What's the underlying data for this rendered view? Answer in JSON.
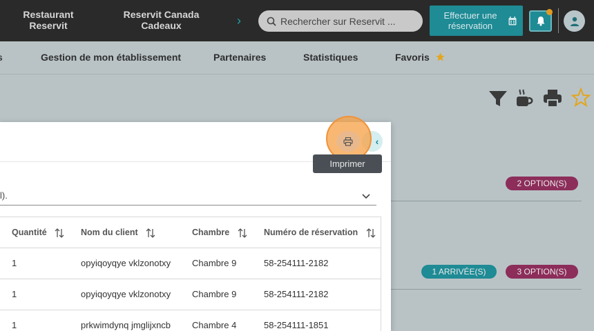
{
  "topbar": {
    "link1": "Restaurant Reservit",
    "link2": "Reservit Canada Cadeaux",
    "search_placeholder": "Rechercher sur Reservit ...",
    "book_label": "Effectuer une réservation"
  },
  "subnav": {
    "items": [
      "s",
      "Gestion de mon établissement",
      "Partenaires",
      "Statistiques",
      "Favoris"
    ]
  },
  "badges": {
    "options_2": "2 OPTION(S)",
    "arrivals_1": "1 ARRIVÉE(S)",
    "options_3": "3 OPTION(S)"
  },
  "modal": {
    "select_value": "l).",
    "tooltip": "Imprimer",
    "close_glyph": "‹",
    "columns": [
      "Quantité",
      "Nom du client",
      "Chambre",
      "Numéro de réservation"
    ],
    "rows": [
      {
        "qty": "1",
        "client": "opyiqoyqye vklzonotxy",
        "room": "Chambre 9",
        "booking": "58-254111-2182"
      },
      {
        "qty": "1",
        "client": "opyiqoyqye vklzonotxy",
        "room": "Chambre 9",
        "booking": "58-254111-2182"
      },
      {
        "qty": "1",
        "client": "prkwimdynq jmglijxncb",
        "room": "Chambre 4",
        "booking": "58-254111-1851"
      }
    ]
  },
  "colors": {
    "accent": "#1e8b95",
    "badge_purple": "#8c2d5a",
    "badge_teal": "#1e8b95",
    "highlight": "#f0923a"
  }
}
